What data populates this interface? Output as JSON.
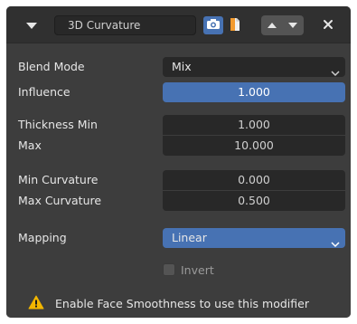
{
  "header": {
    "modifier_name": "3D Curvature",
    "icons": {
      "collapse": "chevron-down-icon",
      "show_in_viewport": "camera-icon",
      "show_in_render": "document-icon",
      "move_up": "chevron-up-icon",
      "move_down": "chevron-down-icon",
      "close": "close-icon"
    }
  },
  "fields": {
    "blend_mode": {
      "label": "Blend Mode",
      "value": "Mix"
    },
    "influence": {
      "label": "Influence",
      "value": "1.000"
    },
    "thickness_min": {
      "label": "Thickness Min",
      "value": "1.000"
    },
    "thickness_max": {
      "label": "Max",
      "value": "10.000"
    },
    "min_curvature": {
      "label": "Min Curvature",
      "value": "0.000"
    },
    "max_curvature": {
      "label": "Max Curvature",
      "value": "0.500"
    },
    "mapping": {
      "label": "Mapping",
      "value": "Linear"
    },
    "invert": {
      "label": "Invert",
      "checked": false
    }
  },
  "warning": {
    "icon": "warning-icon",
    "text": "Enable Face Smoothness to use this modifier",
    "color": "#f2b600"
  },
  "colors": {
    "accent": "#4772b3",
    "panel_bg": "#3d3d3d",
    "field_bg": "#282828"
  }
}
